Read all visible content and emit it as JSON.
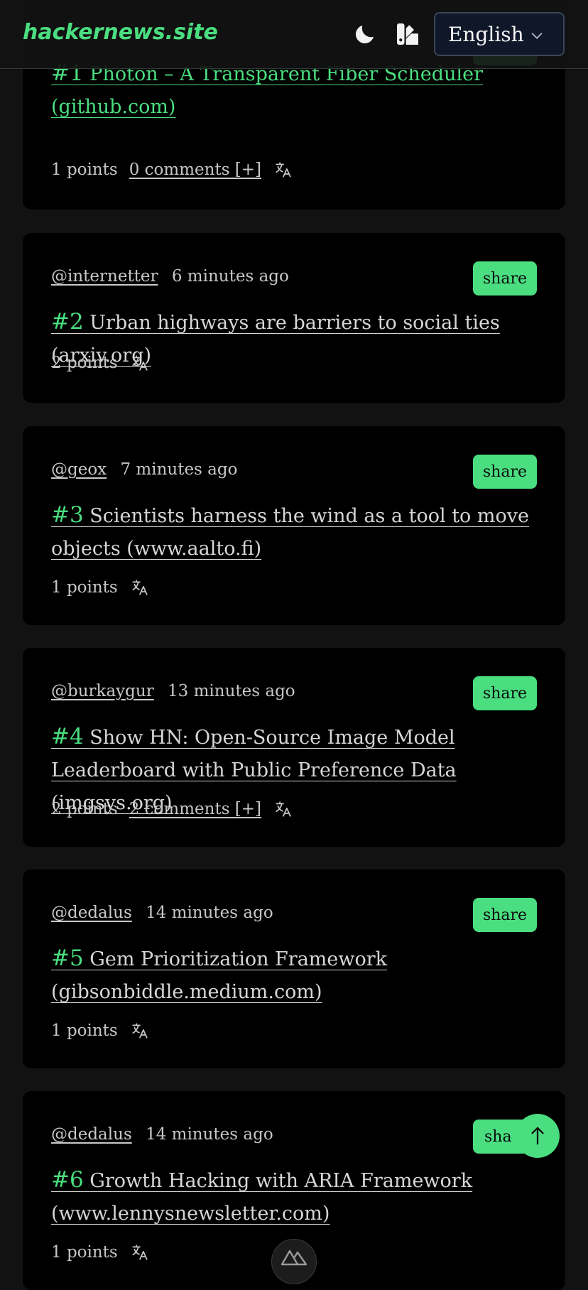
{
  "header": {
    "brand": "hackernews.site",
    "language": "English"
  },
  "share_label": "share",
  "partial_share_label": "sha",
  "stories": [
    {
      "rank": "#1",
      "title": "Photon – A Transparent Fiber Scheduler (github.com)",
      "points": "1 points",
      "comments": "0 comments [+]"
    },
    {
      "rank": "#2",
      "user": "@internetter",
      "time": "6 minutes ago",
      "title": "Urban highways are barriers to social ties (arxiv.org)",
      "points": "2 points"
    },
    {
      "rank": "#3",
      "user": "@geox",
      "time": "7 minutes ago",
      "title": "Scientists harness the wind as a tool to move objects (www.aalto.fi)",
      "points": "1 points"
    },
    {
      "rank": "#4",
      "user": "@burkaygur",
      "time": "13 minutes ago",
      "title": "Show HN: Open-Source Image Model Leaderboard with Public Preference Data (imgsys.org)",
      "points": "2 points",
      "comments": "2 comments [+]"
    },
    {
      "rank": "#5",
      "user": "@dedalus",
      "time": "14 minutes ago",
      "title": "Gem Prioritization Framework (gibsonbiddle.medium.com)",
      "points": "1 points"
    },
    {
      "rank": "#6",
      "user": "@dedalus",
      "time": "14 minutes ago",
      "title": "Growth Hacking with ARIA Framework (www.lennysnewsletter.com)",
      "points": "1 points"
    }
  ],
  "colors": {
    "accent": "#4ade80",
    "card": "#000000",
    "background": "#121212"
  },
  "icons": {
    "theme": "moon-icon",
    "palette": "palette-icon",
    "translate": "translate-icon",
    "scroll_top": "arrow-up-icon",
    "devtools": "nuxt-icon"
  }
}
